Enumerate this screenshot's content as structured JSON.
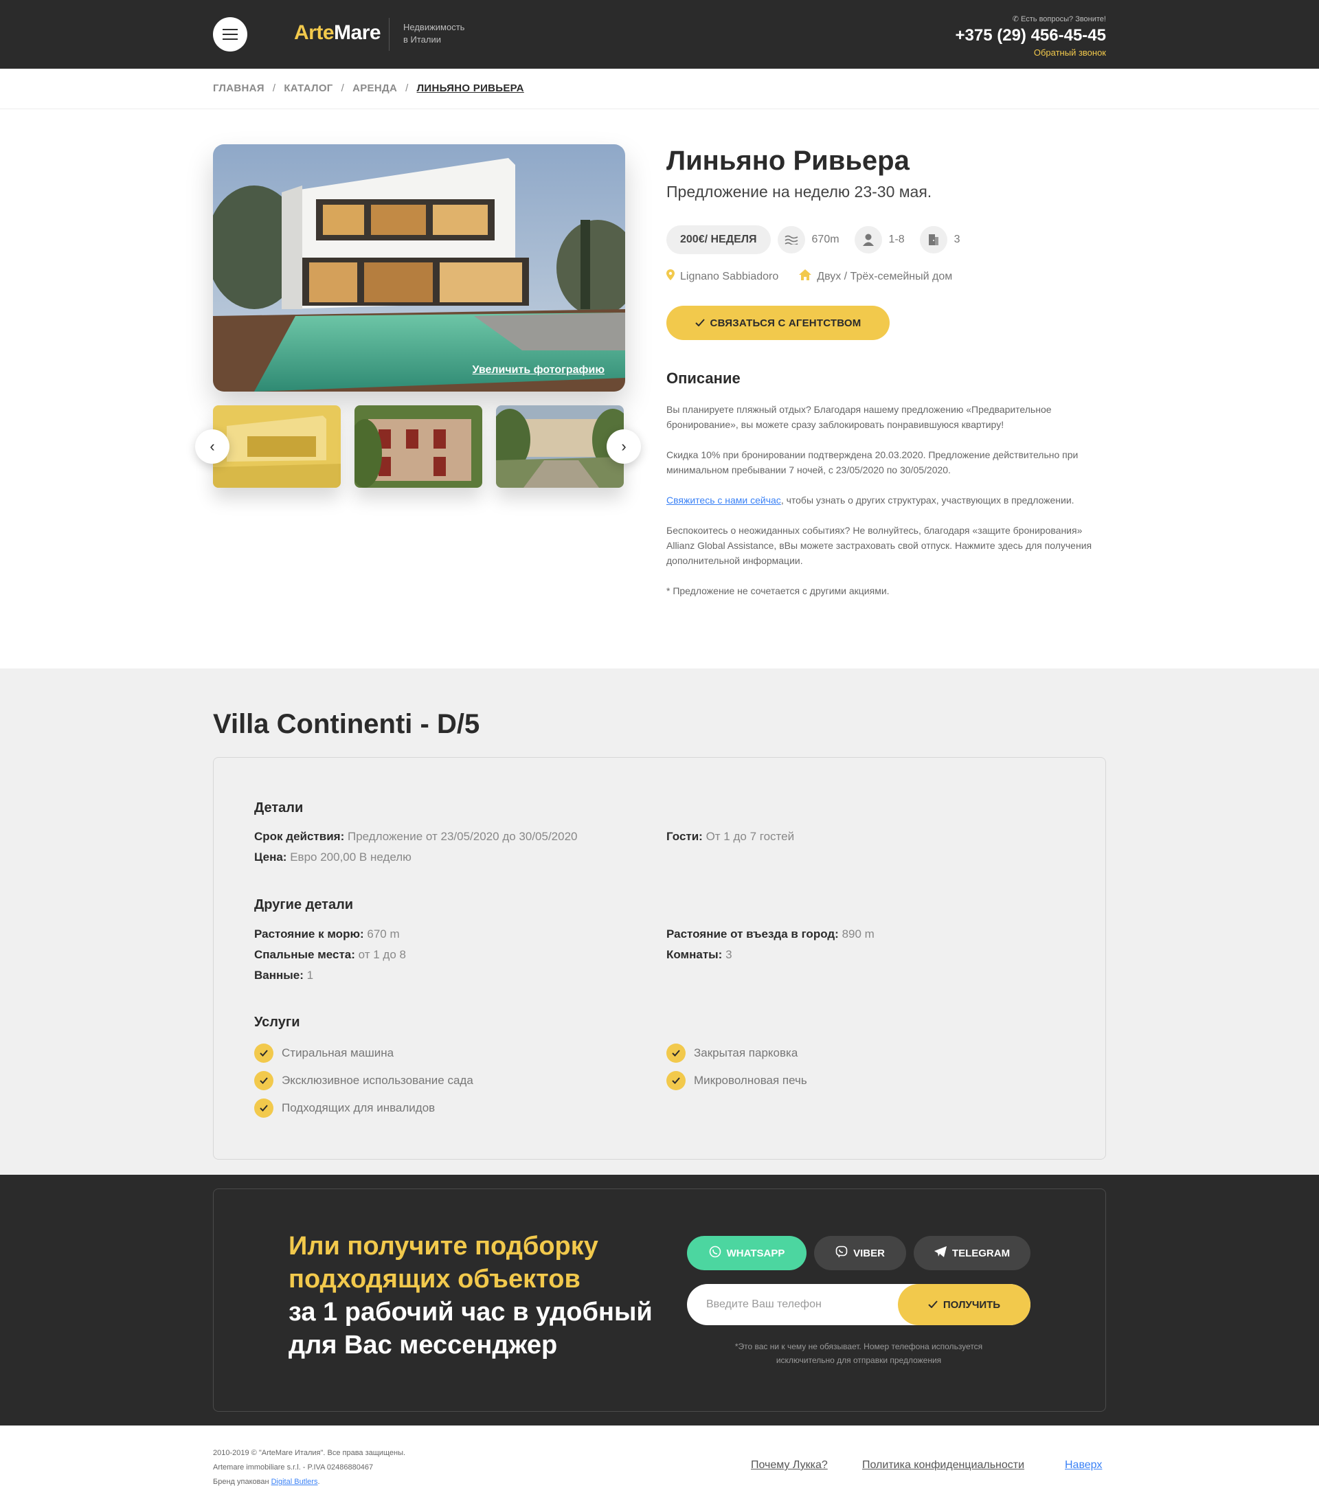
{
  "header": {
    "logo_part1": "Arte",
    "logo_part2": "Mare",
    "tagline_line1": "Недвижимость",
    "tagline_line2": "в Италии",
    "question": "Есть вопросы? Звоните!",
    "phone": "+375 (29) 456-45-45",
    "callback": "Обратный звонок"
  },
  "breadcrumb": [
    "ГЛАВНАЯ",
    "КАТАЛОГ",
    "АРЕНДА",
    "ЛИНЬЯНО РИВЬЕРА"
  ],
  "gallery": {
    "zoom_label": "Увеличить фотографию"
  },
  "listing": {
    "title": "Линьяно Ривьера",
    "subtitle": "Предложение на неделю 23-30 мая.",
    "price": "200€/ НЕДЕЛЯ",
    "sea_distance": "670m",
    "guests": "1-8",
    "rooms": "3",
    "location": "Lignano Sabbiadoro",
    "type": "Двух / Трёх-семейный дом",
    "contact_button": "СВЯЗАТЬСЯ С АГЕНТСТВОМ",
    "description_title": "Описание",
    "desc_p1": "Вы планируете пляжный отдых? Благодаря нашему предложению «Предварительное бронирование», вы можете сразу заблокировать понравившуюся квартиру!",
    "desc_p2": "Скидка 10% при бронировании подтверждена 20.03.2020. Предложение действительно при минимальном пребывании 7 ночей, с 23/05/2020 по 30/05/2020.",
    "desc_p3_link": "Свяжитесь с нами сейчас",
    "desc_p3_rest": ", чтобы узнать о других структурах, участвующих в предложении.",
    "desc_p4": "Беспокоитесь о неожиданных событиях? Не волнуйтесь, благодаря «защите бронирования» Allianz Global Assistance, вВы можете застраховать свой отпуск. Нажмите здесь для получения дополнительной информации.",
    "desc_p5": "* Предложение не сочетается с другими акциями."
  },
  "villa": {
    "title": "Villa Continenti - D/5",
    "details_title": "Детали",
    "validity_label": "Срок действия:",
    "validity_value": "Предложение от 23/05/2020 до 30/05/2020",
    "price_label": "Цена:",
    "price_value": "Евро 200,00 В неделю",
    "guests_label": "Гости:",
    "guests_value": "От 1 до 7 гостей",
    "other_title": "Другие детали",
    "sea_label": "Растояние к морю:",
    "sea_value": "670 m",
    "beds_label": "Спальные места:",
    "beds_value": "от 1 до 8",
    "baths_label": "Ванные:",
    "baths_value": "1",
    "city_label": "Растояние от въезда в город:",
    "city_value": "890 m",
    "rooms_label": "Комнаты:",
    "rooms_value": "3",
    "services_title": "Услуги",
    "services_left": [
      "Стиральная машина",
      "Эксклюзивное использование сада",
      "Подходящих для инвалидов"
    ],
    "services_right": [
      "Закрытая парковка",
      "Микроволновая печь"
    ]
  },
  "cta": {
    "line1": "Или получите подборку",
    "line2": "подходящих объектов",
    "line3": "за 1 рабочий час в удобный",
    "line4": "для Вас мессенджер",
    "whatsapp": "WHATSAPP",
    "viber": "VIBER",
    "telegram": "TELEGRAM",
    "phone_placeholder": "Введите Ваш телефон",
    "get_button": "ПОЛУЧИТЬ",
    "note_line1": "*Это вас ни к чему не обязывает. Номер телефона используется",
    "note_line2": "исключительно для отправки предложения",
    "colors": {
      "accent": "#f2c94c",
      "whatsapp": "#4cd6a0",
      "dark": "#2b2b2b",
      "button_dark": "#444444"
    }
  },
  "footer": {
    "copyright": "2010-2019 © \"ArteMare Италия\". Все права защищены.",
    "company": "Artemare immobiliare s.r.l. - P.IVA 02486880467",
    "brand_prefix": "Бренд упакован ",
    "brand_link": "Digital Butlers",
    "brand_suffix": ".",
    "link_why": "Почему Лукка?",
    "link_privacy": "Политика конфиденциальности",
    "link_top": "Наверх"
  }
}
